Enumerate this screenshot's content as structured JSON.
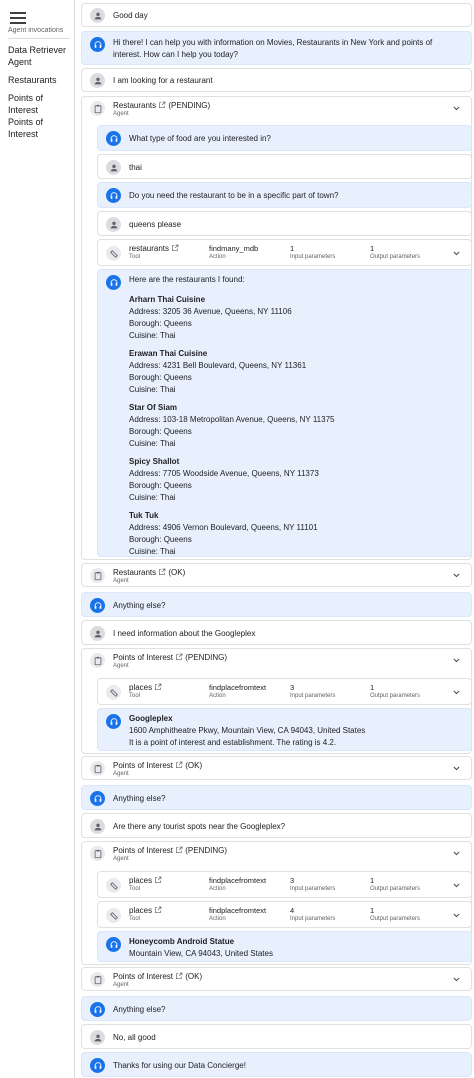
{
  "sidebar": {
    "heading": "Agent invocations",
    "items": [
      {
        "label": "Data Retriever Agent"
      },
      {
        "label": "Restaurants"
      },
      {
        "label": "Points of Interest"
      },
      {
        "label": "Points of Interest"
      }
    ]
  },
  "labels": {
    "agent": "Agent",
    "tool": "Tool",
    "action": "Action",
    "input_parameters": "Input parameters",
    "output_parameters": "Output parameters"
  },
  "messages": {
    "m1": "Good day",
    "m2": "Hi there! I can help you with information on Movies, Restaurants in New York and points of interest. How can I help you today?",
    "m3": "I am looking for a restaurant",
    "a1_name": "Restaurants",
    "a1_status": "(PENDING)",
    "m4": "What type of food are you interested in?",
    "m5": "thai",
    "m6": "Do you need the restaurant to be in a specific part of town?",
    "m7": "queens please",
    "t1_name": "restaurants",
    "t1_action": "findmany_mdb",
    "t1_in": "1",
    "t1_out": "1",
    "m8_intro": "Here are the restaurants I found:",
    "restaurants": [
      {
        "name": "Arharn Thai Cuisine",
        "address": "Address: 3205 36 Avenue, Queens, NY 11106",
        "borough": "Borough: Queens",
        "cuisine": "Cuisine: Thai"
      },
      {
        "name": "Erawan Thai Cuisine",
        "address": "Address: 4231 Bell Boulevard, Queens, NY 11361",
        "borough": "Borough: Queens",
        "cuisine": "Cuisine: Thai"
      },
      {
        "name": "Star Of Siam",
        "address": "Address: 103-18 Metropolitan Avenue, Queens, NY 11375",
        "borough": "Borough: Queens",
        "cuisine": "Cuisine: Thai"
      },
      {
        "name": "Spicy Shallot",
        "address": "Address: 7705 Woodside Avenue, Queens, NY 11373",
        "borough": "Borough: Queens",
        "cuisine": "Cuisine: Thai"
      },
      {
        "name": "Tuk Tuk",
        "address": "Address: 4906 Vernon Boulevard, Queens, NY 11101",
        "borough": "Borough: Queens",
        "cuisine": "Cuisine: Thai"
      }
    ],
    "a2_name": "Restaurants",
    "a2_status": "(OK)",
    "m9": "Anything else?",
    "m10": "I need information about the Googleplex",
    "a3_name": "Points of Interest",
    "a3_status": "(PENDING)",
    "t2_name": "places",
    "t2_action": "findplacefromtext",
    "t2_in": "3",
    "t2_out": "1",
    "m11_title": "Googleplex",
    "m11_l1": "1600 Amphitheatre Pkwy, Mountain View, CA 94043, United States",
    "m11_l2": "It is a point of interest and establishment. The rating is 4.2.",
    "a4_name": "Points of Interest",
    "a4_status": "(OK)",
    "m12": "Anything else?",
    "m13": "Are there any tourist spots near the Googleplex?",
    "a5_name": "Points of Interest",
    "a5_status": "(PENDING)",
    "t3_name": "places",
    "t3_action": "findplacefromtext",
    "t3_in": "3",
    "t3_out": "1",
    "t4_name": "places",
    "t4_action": "findplacefromtext",
    "t4_in": "4",
    "t4_out": "1",
    "m14_title": "Honeycomb Android Statue",
    "m14_l1": "Mountain View, CA 94043, United States",
    "a6_name": "Points of Interest",
    "a6_status": "(OK)",
    "m15": "Anything else?",
    "m16": "No, all good",
    "m17": "Thanks for using our Data Concierge!"
  }
}
